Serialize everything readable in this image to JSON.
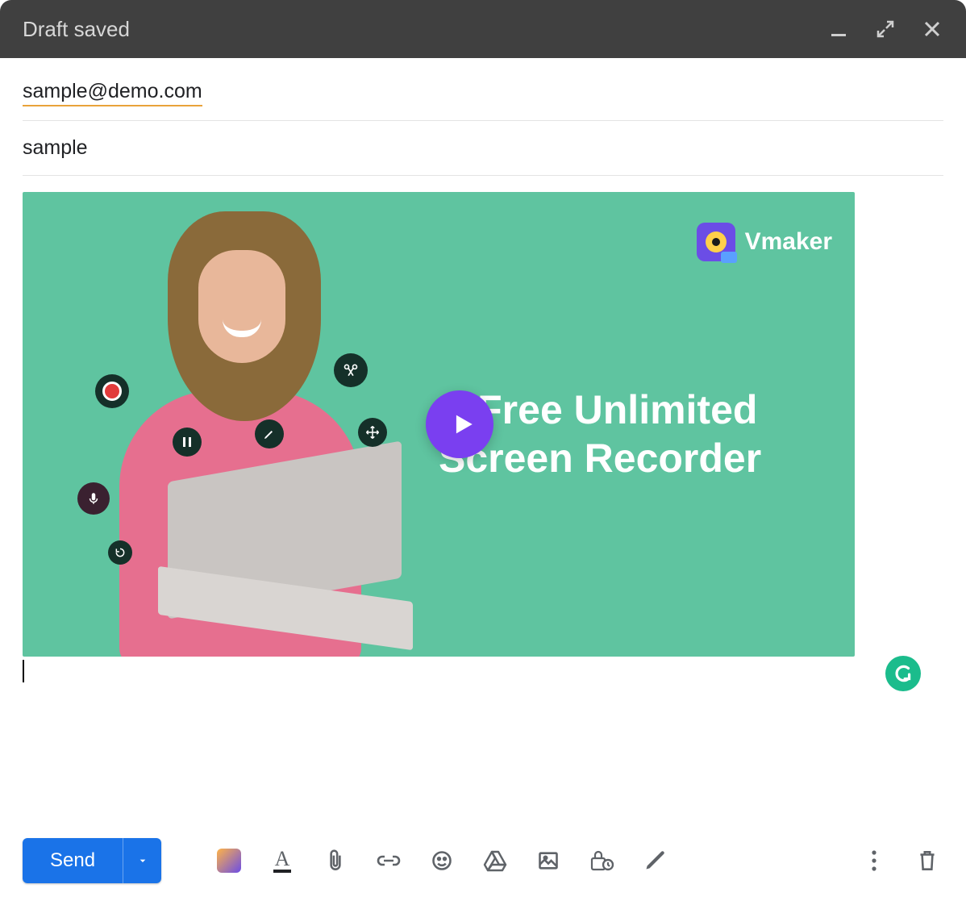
{
  "titlebar": {
    "title": "Draft saved"
  },
  "fields": {
    "recipient": "sample@demo.com",
    "subject": "sample"
  },
  "thumbnail": {
    "brand": "Vmaker",
    "headline_line1": "A Free Unlimited",
    "headline_line2": "Screen Recorder"
  },
  "toolbar": {
    "send_label": "Send"
  }
}
